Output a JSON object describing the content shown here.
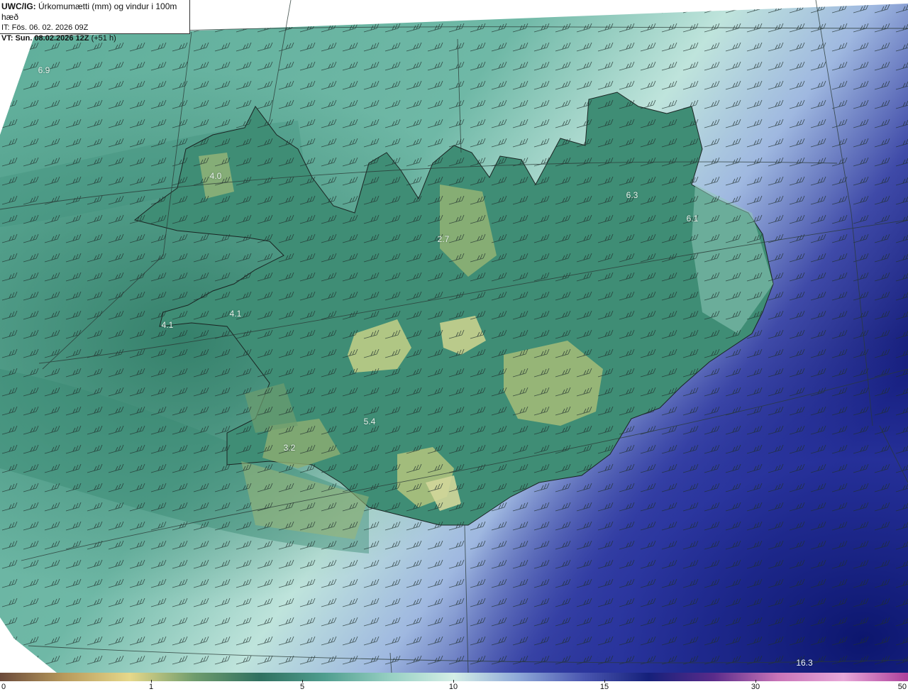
{
  "header": {
    "model": "UWC/IG:",
    "title": "Úrkomumætti (mm) og vindur i 100m hæð",
    "init_time": "IT: Fös. 06. 02. 2026 09Z",
    "valid_label": "VT: Sun. 08.02.2026 12Z",
    "lead_time": "(+51 h)"
  },
  "map_labels": [
    "6.9",
    "4.0",
    "2.7",
    "6.3",
    "6.1",
    "4.1",
    "4.1",
    "5.4",
    "3.2",
    "16.3"
  ],
  "colorbar": {
    "ticks": [
      "0",
      "1",
      "5",
      "10",
      "15",
      "30",
      "50"
    ],
    "colors": [
      "#6b4a3a",
      "#b89a5c",
      "#e6d88a",
      "#6f9c6d",
      "#2f7060",
      "#4f9d8e",
      "#96cfc2",
      "#d4eee6",
      "#8ea8d8",
      "#4a56b0",
      "#15207a",
      "#5a2b8a",
      "#c974b8",
      "#e8a8d8",
      "#ad3f9b"
    ]
  },
  "palette": {
    "sea_light": "#d4ede6",
    "sea_mid": "#8fcbbd",
    "land_green": "#3f8d75",
    "highland": "#b8c880",
    "sea_blue": "#7e99d4",
    "deep_blue": "#14207e",
    "border_line": "#2a3a36"
  }
}
